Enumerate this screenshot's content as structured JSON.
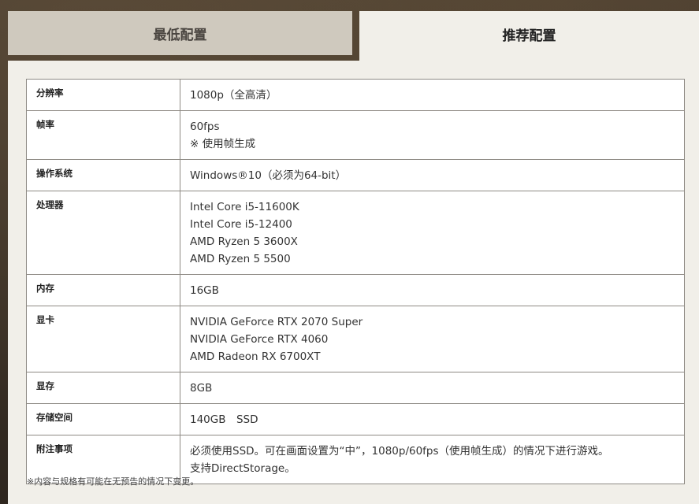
{
  "tabs": {
    "minimum": "最低配置",
    "recommended": "推荐配置"
  },
  "specs": [
    {
      "label": "分辨率",
      "lines": [
        "1080p（全高清）"
      ]
    },
    {
      "label": "帧率",
      "lines": [
        "60fps",
        "※ 使用帧生成"
      ]
    },
    {
      "label": "操作系统",
      "lines": [
        "Windows®10（必须为64-bit）"
      ]
    },
    {
      "label": "处理器",
      "lines": [
        "Intel Core i5-11600K",
        "Intel Core i5-12400",
        "AMD Ryzen 5 3600X",
        "AMD Ryzen 5 5500"
      ]
    },
    {
      "label": "内存",
      "lines": [
        "16GB"
      ]
    },
    {
      "label": "显卡",
      "lines": [
        "NVIDIA GeForce RTX 2070 Super",
        "NVIDIA GeForce RTX 4060",
        "AMD Radeon RX 6700XT"
      ]
    },
    {
      "label": "显存",
      "lines": [
        "8GB"
      ]
    },
    {
      "label": "存储空间",
      "lines": [
        "140GB　SSD"
      ]
    },
    {
      "label": "附注事项",
      "lines": [
        "必须使用SSD。可在画面设置为“中”，1080p/60fps（使用帧生成）的情况下进行游戏。",
        "支持DirectStorage。"
      ]
    }
  ],
  "footnote": "※内容与规格有可能在无预告的情况下变更。"
}
